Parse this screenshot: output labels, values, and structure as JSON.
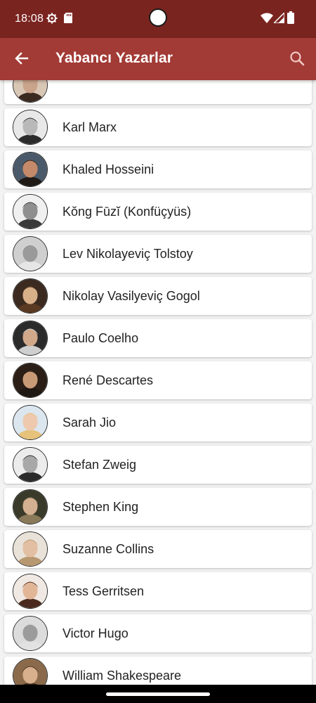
{
  "status": {
    "time": "18:08",
    "icons": [
      "gear-icon",
      "sd-card-icon",
      "wifi-icon",
      "signal-icon",
      "battery-icon"
    ]
  },
  "appbar": {
    "title": "Yabancı Yazarlar",
    "back_icon": "arrow-left-icon",
    "search_icon": "search-icon",
    "color": "#a23a35",
    "status_color": "#7a2420"
  },
  "authors": [
    {
      "name": "",
      "avatar": {
        "bg": "#d9c7b5",
        "face": "#c9a48a",
        "hair": "#3a2a20"
      }
    },
    {
      "name": "Karl Marx",
      "avatar": {
        "bg": "#e8e8e8",
        "face": "#b9b9b9",
        "hair": "#2b2b2b"
      }
    },
    {
      "name": "Khaled Hosseini",
      "avatar": {
        "bg": "#4a5a6a",
        "face": "#c48a6a",
        "hair": "#1f1a16"
      }
    },
    {
      "name": "Kŏng Fūzĭ (Konfüçyüs)",
      "avatar": {
        "bg": "#f0f0f0",
        "face": "#8f8f8f",
        "hair": "#3a3a3a"
      }
    },
    {
      "name": "Lev Nikolayeviç Tolstoy",
      "avatar": {
        "bg": "#cfcfcf",
        "face": "#9a9a9a",
        "hair": "#e6e6e6"
      }
    },
    {
      "name": "Nikolay Vasilyeviç Gogol",
      "avatar": {
        "bg": "#3b2a20",
        "face": "#d7b08a",
        "hair": "#5a3a22"
      }
    },
    {
      "name": "Paulo Coelho",
      "avatar": {
        "bg": "#2b2b2b",
        "face": "#d1a88a",
        "hair": "#cfcfcf"
      }
    },
    {
      "name": "René Descartes",
      "avatar": {
        "bg": "#2a1e16",
        "face": "#c99a76",
        "hair": "#1e1610"
      }
    },
    {
      "name": "Sarah Jio",
      "avatar": {
        "bg": "#dbe6ef",
        "face": "#efc9ae",
        "hair": "#e6c27a"
      }
    },
    {
      "name": "Stefan Zweig",
      "avatar": {
        "bg": "#ececec",
        "face": "#a8a8a8",
        "hair": "#2a2a2a"
      }
    },
    {
      "name": "Stephen King",
      "avatar": {
        "bg": "#3a3a2a",
        "face": "#d3b091",
        "hair": "#8a7a5a"
      }
    },
    {
      "name": "Suzanne Collins",
      "avatar": {
        "bg": "#e9e2d8",
        "face": "#e2bfa2",
        "hair": "#b89870"
      }
    },
    {
      "name": "Tess Gerritsen",
      "avatar": {
        "bg": "#f0e8e2",
        "face": "#e1b697",
        "hair": "#4a2a1e"
      }
    },
    {
      "name": "Victor Hugo",
      "avatar": {
        "bg": "#dcdcdc",
        "face": "#9c9c9c",
        "hair": "#e2e2e2"
      }
    },
    {
      "name": "William Shakespeare",
      "avatar": {
        "bg": "#8a6a4a",
        "face": "#d8b08e",
        "hair": "#3a2616"
      }
    }
  ]
}
